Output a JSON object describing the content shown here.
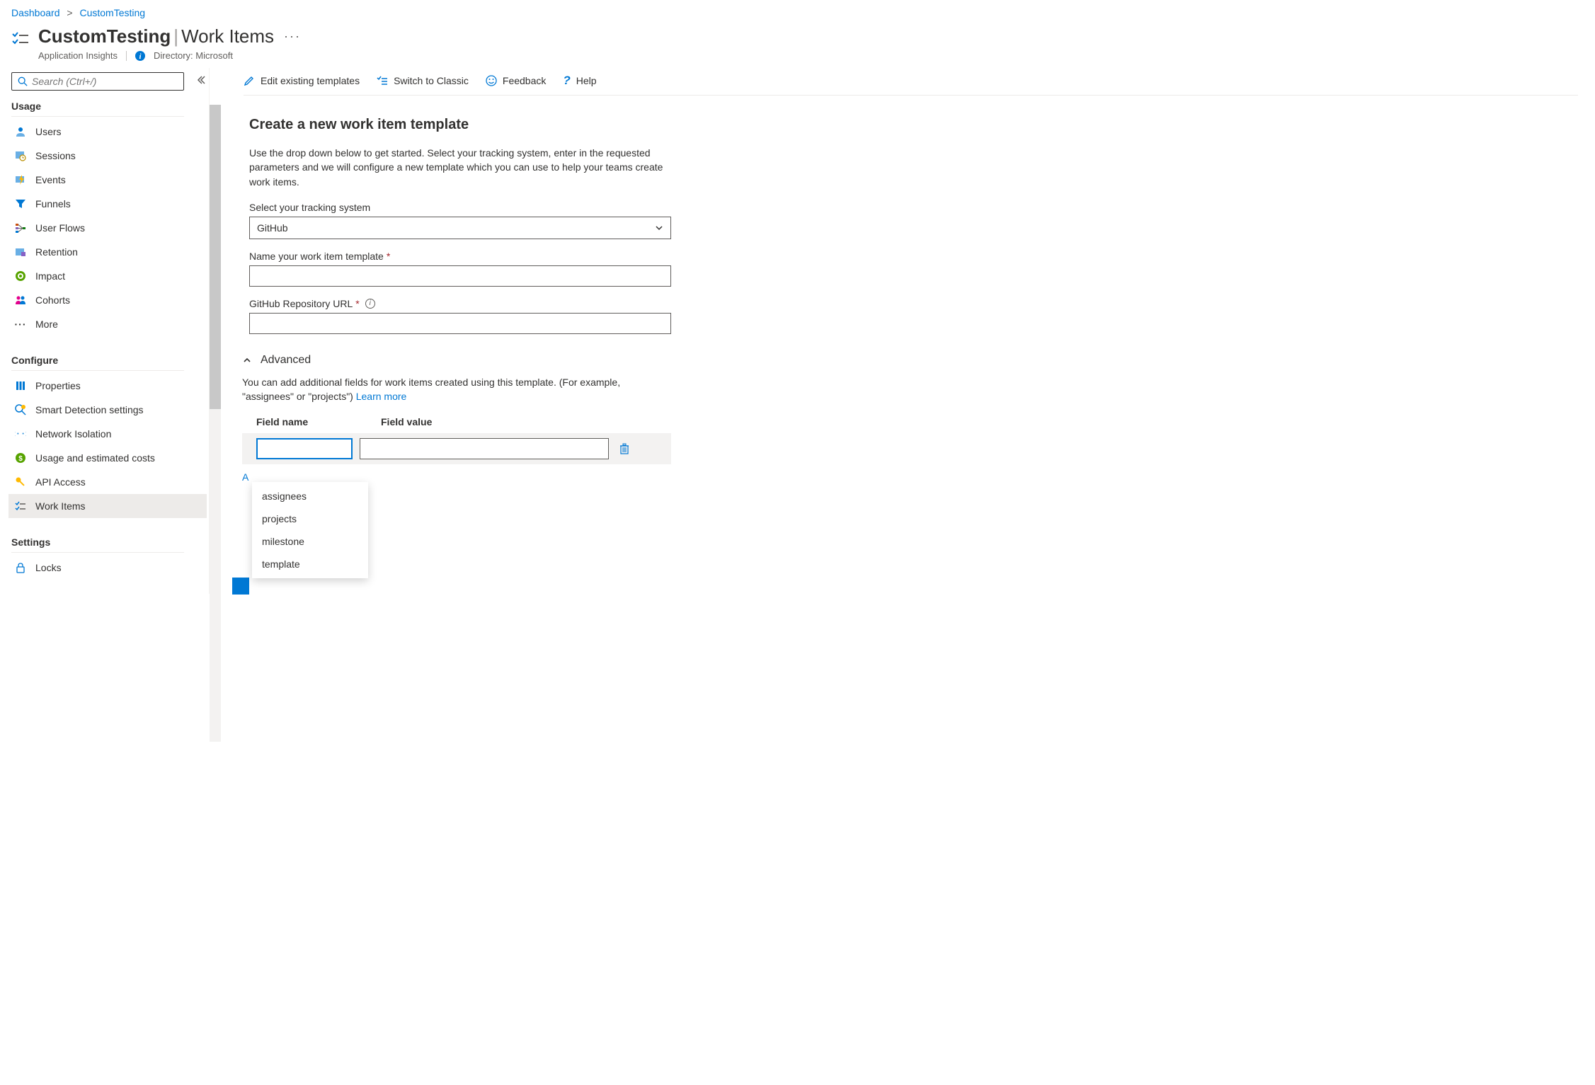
{
  "breadcrumb": {
    "root": "Dashboard",
    "current": "CustomTesting"
  },
  "header": {
    "title_main": "CustomTesting",
    "title_section": "Work Items",
    "subtitle": "Application Insights",
    "directory_label": "Directory:",
    "directory_value": "Microsoft"
  },
  "search": {
    "placeholder": "Search (Ctrl+/)"
  },
  "nav": {
    "sections": [
      {
        "title": "Usage",
        "items": [
          {
            "key": "users",
            "label": "Users",
            "icon": "user-icon"
          },
          {
            "key": "sessions",
            "label": "Sessions",
            "icon": "clock-list-icon"
          },
          {
            "key": "events",
            "label": "Events",
            "icon": "lightning-icon"
          },
          {
            "key": "funnels",
            "label": "Funnels",
            "icon": "funnel-icon"
          },
          {
            "key": "user-flows",
            "label": "User Flows",
            "icon": "flows-icon"
          },
          {
            "key": "retention",
            "label": "Retention",
            "icon": "retention-icon"
          },
          {
            "key": "impact",
            "label": "Impact",
            "icon": "impact-icon"
          },
          {
            "key": "cohorts",
            "label": "Cohorts",
            "icon": "cohorts-icon"
          },
          {
            "key": "more",
            "label": "More",
            "icon": "more-icon"
          }
        ]
      },
      {
        "title": "Configure",
        "items": [
          {
            "key": "properties",
            "label": "Properties",
            "icon": "properties-icon"
          },
          {
            "key": "smart-detection",
            "label": "Smart Detection settings",
            "icon": "smart-detection-icon"
          },
          {
            "key": "network-isolation",
            "label": "Network Isolation",
            "icon": "network-icon"
          },
          {
            "key": "usage-costs",
            "label": "Usage and estimated costs",
            "icon": "costs-icon"
          },
          {
            "key": "api-access",
            "label": "API Access",
            "icon": "key-icon"
          },
          {
            "key": "work-items",
            "label": "Work Items",
            "icon": "work-items-icon",
            "active": true
          }
        ]
      },
      {
        "title": "Settings",
        "items": [
          {
            "key": "locks",
            "label": "Locks",
            "icon": "lock-icon"
          }
        ]
      }
    ]
  },
  "toolbar": {
    "edit_templates": "Edit existing templates",
    "switch_classic": "Switch to Classic",
    "feedback": "Feedback",
    "help": "Help"
  },
  "form": {
    "heading": "Create a new work item template",
    "description": "Use the drop down below to get started. Select your tracking system, enter in the requested parameters and we will configure a new template which you can use to help your teams create work items.",
    "tracking_label": "Select your tracking system",
    "tracking_value": "GitHub",
    "name_label": "Name your work item template",
    "repo_label": "GitHub Repository URL"
  },
  "advanced": {
    "title": "Advanced",
    "description_prefix": "You can add additional fields for work items created using this template. (For example, \"assignees\" or \"projects\") ",
    "learn_more": "Learn more",
    "col1": "Field name",
    "col2": "Field value",
    "add_label": "A",
    "dropdown_options": [
      "assignees",
      "projects",
      "milestone",
      "template"
    ]
  }
}
